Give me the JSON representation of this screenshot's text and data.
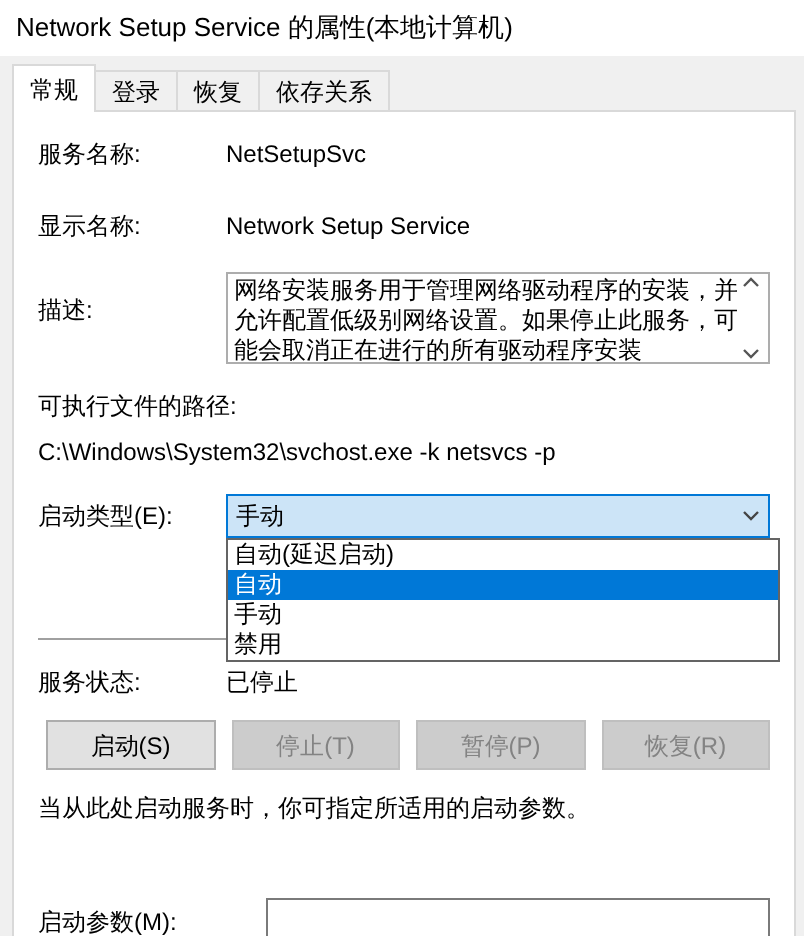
{
  "window": {
    "title": "Network Setup Service 的属性(本地计算机)"
  },
  "tabs": [
    {
      "label": "常规",
      "selected": true
    },
    {
      "label": "登录",
      "selected": false
    },
    {
      "label": "恢复",
      "selected": false
    },
    {
      "label": "依存关系",
      "selected": false
    }
  ],
  "service_name": {
    "label": "服务名称:",
    "value": "NetSetupSvc"
  },
  "display_name": {
    "label": "显示名称:",
    "value": "Network Setup Service"
  },
  "description": {
    "label": "描述:",
    "value": "网络安装服务用于管理网络驱动程序的安装，并允许配置低级别网络设置。如果停止此服务，可能会取消正在进行的所有驱动程序安装"
  },
  "executable_path": {
    "label": "可执行文件的路径:",
    "value": "C:\\Windows\\System32\\svchost.exe -k netsvcs -p"
  },
  "startup_type": {
    "label": "启动类型(E):",
    "value": "手动",
    "expanded": true,
    "options": [
      {
        "label": "自动(延迟启动)",
        "highlighted": false
      },
      {
        "label": "自动",
        "highlighted": true
      },
      {
        "label": "手动",
        "highlighted": false
      },
      {
        "label": "禁用",
        "highlighted": false
      }
    ]
  },
  "service_status": {
    "label": "服务状态:",
    "value": "已停止"
  },
  "buttons": [
    {
      "label": "启动(S)",
      "disabled": false
    },
    {
      "label": "停止(T)",
      "disabled": true
    },
    {
      "label": "暂停(P)",
      "disabled": true
    },
    {
      "label": "恢复(R)",
      "disabled": true
    }
  ],
  "note": "当从此处启动服务时，你可指定所适用的启动参数。",
  "start_parameters": {
    "label": "启动参数(M):"
  }
}
